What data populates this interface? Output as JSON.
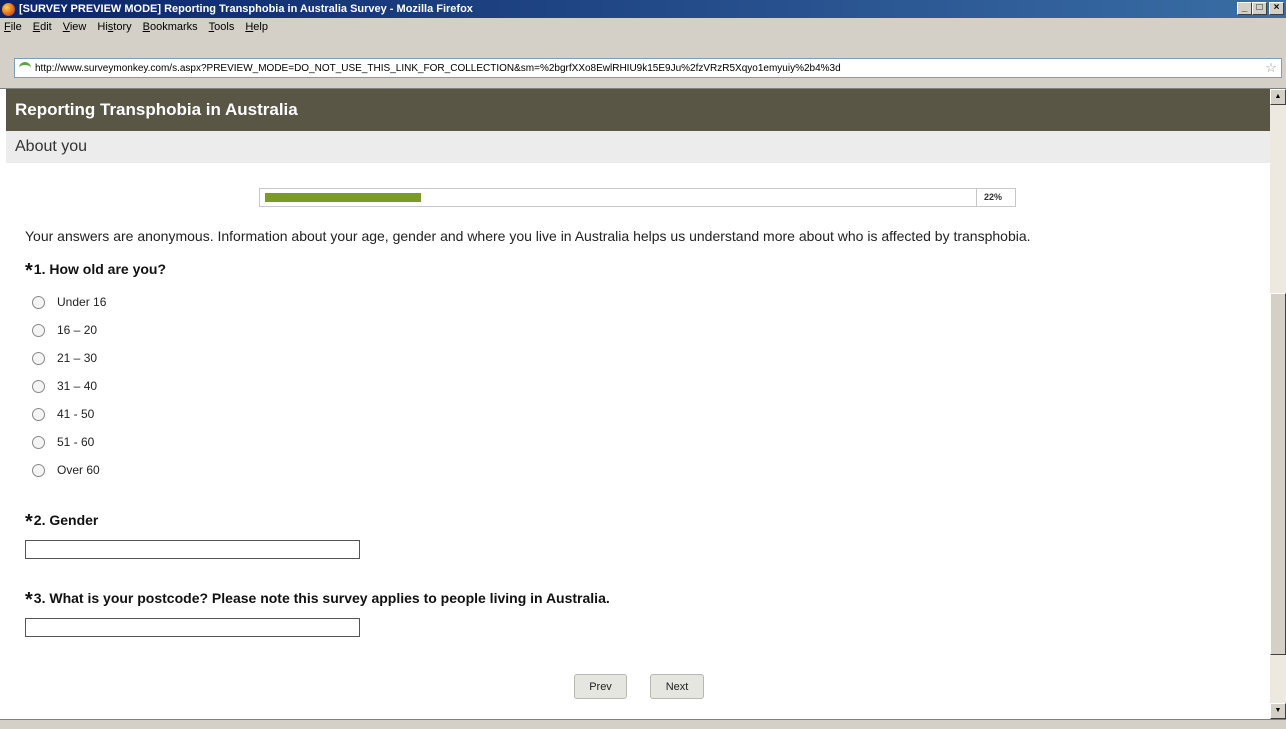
{
  "window": {
    "title": "[SURVEY PREVIEW MODE] Reporting Transphobia in Australia Survey - Mozilla Firefox",
    "minimize_glyph": "_",
    "maximize_glyph": "□",
    "close_glyph": "×"
  },
  "menu": {
    "file_rest": "ile",
    "file_key": "F",
    "edit_rest": "dit",
    "edit_key": "E",
    "view_rest": "iew",
    "view_key": "V",
    "history_pre": "Hi",
    "history_key": "s",
    "history_rest": "tory",
    "bookmarks_rest": "ookmarks",
    "bookmarks_key": "B",
    "tools_rest": "ools",
    "tools_key": "T",
    "help_rest": "elp",
    "help_key": "H"
  },
  "address": {
    "url": "http://www.surveymonkey.com/s.aspx?PREVIEW_MODE=DO_NOT_USE_THIS_LINK_FOR_COLLECTION&sm=%2bgrfXXo8EwlRHIU9k15E9Ju%2fzVRzR5Xqyo1emyuiy%2b4%3d",
    "star_glyph": "☆"
  },
  "survey": {
    "title": "Reporting Transphobia in Australia",
    "page_title": "About you",
    "progress_percent": 22,
    "progress_label": "22%",
    "intro": "Your answers are anonymous. Information about your age, gender and where you live in Australia helps us understand more about who is affected by transphobia."
  },
  "questions": {
    "required_mark": "*",
    "q1": {
      "title": "1. How old are you?",
      "options": [
        "Under 16",
        "16 – 20",
        "21 – 30",
        "31 – 40",
        "41 - 50",
        "51 - 60",
        "Over 60"
      ]
    },
    "q2": {
      "title": "2. Gender",
      "value": ""
    },
    "q3": {
      "title": "3. What is your postcode? Please note this survey applies to people living in Australia.",
      "value": ""
    }
  },
  "nav": {
    "prev_label": "Prev",
    "next_label": "Next"
  },
  "scroll": {
    "up_glyph": "▲",
    "down_glyph": "▼"
  },
  "colors": {
    "header_bg": "#5a5646",
    "page_title_bg": "#ececec",
    "progress_fill": "#7a9a2a"
  }
}
